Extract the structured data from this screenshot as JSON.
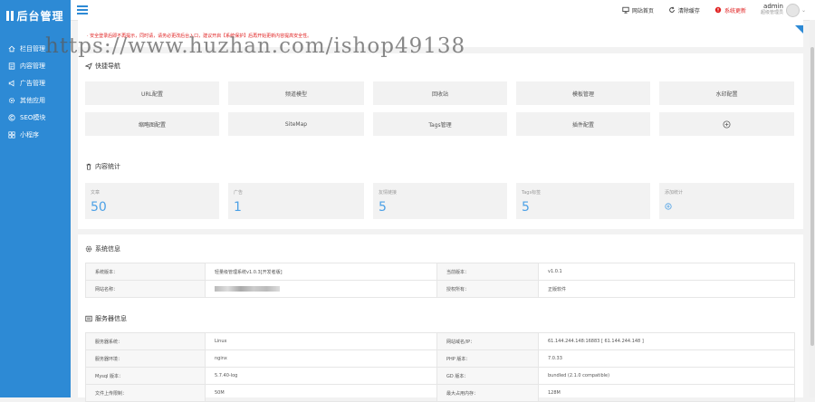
{
  "sidebar": {
    "logo": "后台管理",
    "items": [
      {
        "label": "栏目管理",
        "icon": "home-icon"
      },
      {
        "label": "内容管理",
        "icon": "document-icon"
      },
      {
        "label": "广告管理",
        "icon": "megaphone-icon"
      },
      {
        "label": "其他应用",
        "icon": "gear-icon"
      },
      {
        "label": "SEO模块",
        "icon": "copyright-icon"
      },
      {
        "label": "小程序",
        "icon": "grid-icon"
      }
    ]
  },
  "topbar": {
    "site_home": "网站首页",
    "clear_cache": "清除缓存",
    "system_update": "系统更新",
    "username": "admin",
    "role": "超级管理员"
  },
  "notice": {
    "text": "· 安全登录后即不再提示，同时请，请务必更改后台入口，建议开启【系统保护】后再开始更新内容提高安全性。"
  },
  "quick_nav": {
    "title": "快捷导航",
    "items": [
      "URL配置",
      "频道模型",
      "回收站",
      "模板管理",
      "水印配置",
      "缩略图配置",
      "SiteMap",
      "Tags管理",
      "插件配置"
    ]
  },
  "content_stats": {
    "title": "内容统计",
    "items": [
      {
        "label": "文章",
        "value": "50"
      },
      {
        "label": "广告",
        "value": "1"
      },
      {
        "label": "友情链接",
        "value": "5"
      },
      {
        "label": "Tags标签",
        "value": "5"
      },
      {
        "label": "添加统计",
        "value": ""
      }
    ]
  },
  "system_info": {
    "title": "系统信息",
    "rows": [
      {
        "k1": "系统版本：",
        "v1": "轻量级管理系统v1.0.3[开发者版]",
        "k2": "当前版本：",
        "v2": "v1.0.1"
      },
      {
        "k1": "网站名称：",
        "v1": "",
        "k2": "授权所有：",
        "v2": "正版软件"
      }
    ]
  },
  "server_info": {
    "title": "服务器信息",
    "rows": [
      {
        "k1": "服务器系统：",
        "v1": "Linux",
        "k2": "网站域名/IP：",
        "v2": "61.144.244.148:16883 [ 61.144.244.148 ]"
      },
      {
        "k1": "服务器环境：",
        "v1": "nginx",
        "k2": "PHP 版本：",
        "v2": "7.0.33"
      },
      {
        "k1": "Mysql 版本：",
        "v1": "5.7.40-log",
        "k2": "GD 版本：",
        "v2": "bundled (2.1.0 compatible)"
      },
      {
        "k1": "文件上传限制：",
        "v1": "50M",
        "k2": "最大占用内存：",
        "v2": "128M"
      }
    ]
  },
  "watermark": "https://www.huzhan.com/ishop49138",
  "colors": {
    "primary": "#2d8ad5",
    "alert": "#e02020",
    "stat_value": "#4da1e6"
  }
}
